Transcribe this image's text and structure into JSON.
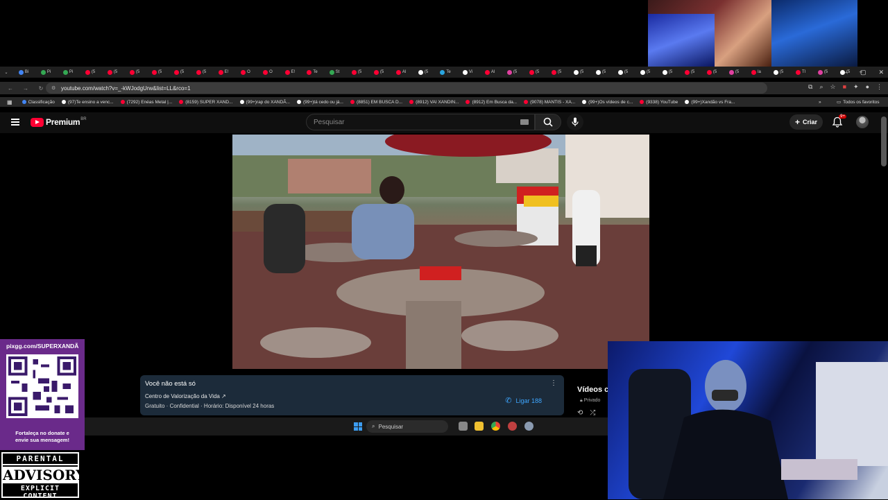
{
  "browser": {
    "url": "youtube.com/watch?v=_-kWJodgUrw&list=LL&rco=1",
    "tabs": [
      "Bi",
      "Pi",
      "Pi",
      "(5",
      "(5",
      "(5",
      "(5",
      "(5",
      "(5",
      "E!",
      "O",
      "O",
      "E!",
      "Te",
      "St",
      "(5",
      "(5",
      "Al",
      "(5",
      "Te",
      "Vi",
      "Al",
      "(5",
      "(5",
      "(5",
      "(5",
      "(5",
      "(5",
      "(5",
      "(5",
      "(5",
      "(5",
      "(5",
      "la",
      "(5",
      "Tl",
      "(5",
      "(5"
    ],
    "bookmarks": [
      {
        "label": "Classificação",
        "color": "#4285f4"
      },
      {
        "label": "(97)Te ensino a venc...",
        "color": "#ffffff"
      },
      {
        "label": "(7292) Enéas Metal |...",
        "color": "#ff0033"
      },
      {
        "label": "(8159) SUPER XAND...",
        "color": "#ff0033"
      },
      {
        "label": "(99+)rap do XANDÃ...",
        "color": "#ffffff"
      },
      {
        "label": "(99+)tá cedo ou já...",
        "color": "#ffffff"
      },
      {
        "label": "(8851) EM BUSCA D...",
        "color": "#ff0033"
      },
      {
        "label": "(8912) VAI XANDIN...",
        "color": "#ff0033"
      },
      {
        "label": "(8912) Em Busca da...",
        "color": "#ff0033"
      },
      {
        "label": "(9078) MANTIS - XA...",
        "color": "#ff0033"
      },
      {
        "label": "(99+)Os vídeos de c...",
        "color": "#ffffff"
      },
      {
        "label": "(9338) YouTube",
        "color": "#ff0033"
      },
      {
        "label": "(99+)Xandão vs Fra...",
        "color": "#ffffff"
      }
    ],
    "all_favorites": "Todos os favoritos"
  },
  "youtube": {
    "logo_text": "Premium",
    "region": "BR",
    "search_placeholder": "Pesquisar",
    "create_label": "Criar",
    "notifications_badge": "9+"
  },
  "info_card": {
    "title": "Você não está só",
    "org": "Centro de Valorização da Vida ↗",
    "meta": "Gratuito · Confidential · Horário: Disponível 24 horas",
    "call_label": "Ligar 188"
  },
  "sidebar": {
    "heading": "Vídeos c",
    "private": "Privado"
  },
  "taskbar": {
    "search_placeholder": "Pesquisar"
  },
  "overlay": {
    "pix_url": "pixgg.com/SUPERXANDÃ",
    "pix_message_line1": "Fortaleça no donate e",
    "pix_message_line2": "envie sua mensagem!",
    "advisory_top": "PARENTAL",
    "advisory_mid": "ADVISORY",
    "advisory_bottom": "EXPLICIT CONTENT"
  }
}
